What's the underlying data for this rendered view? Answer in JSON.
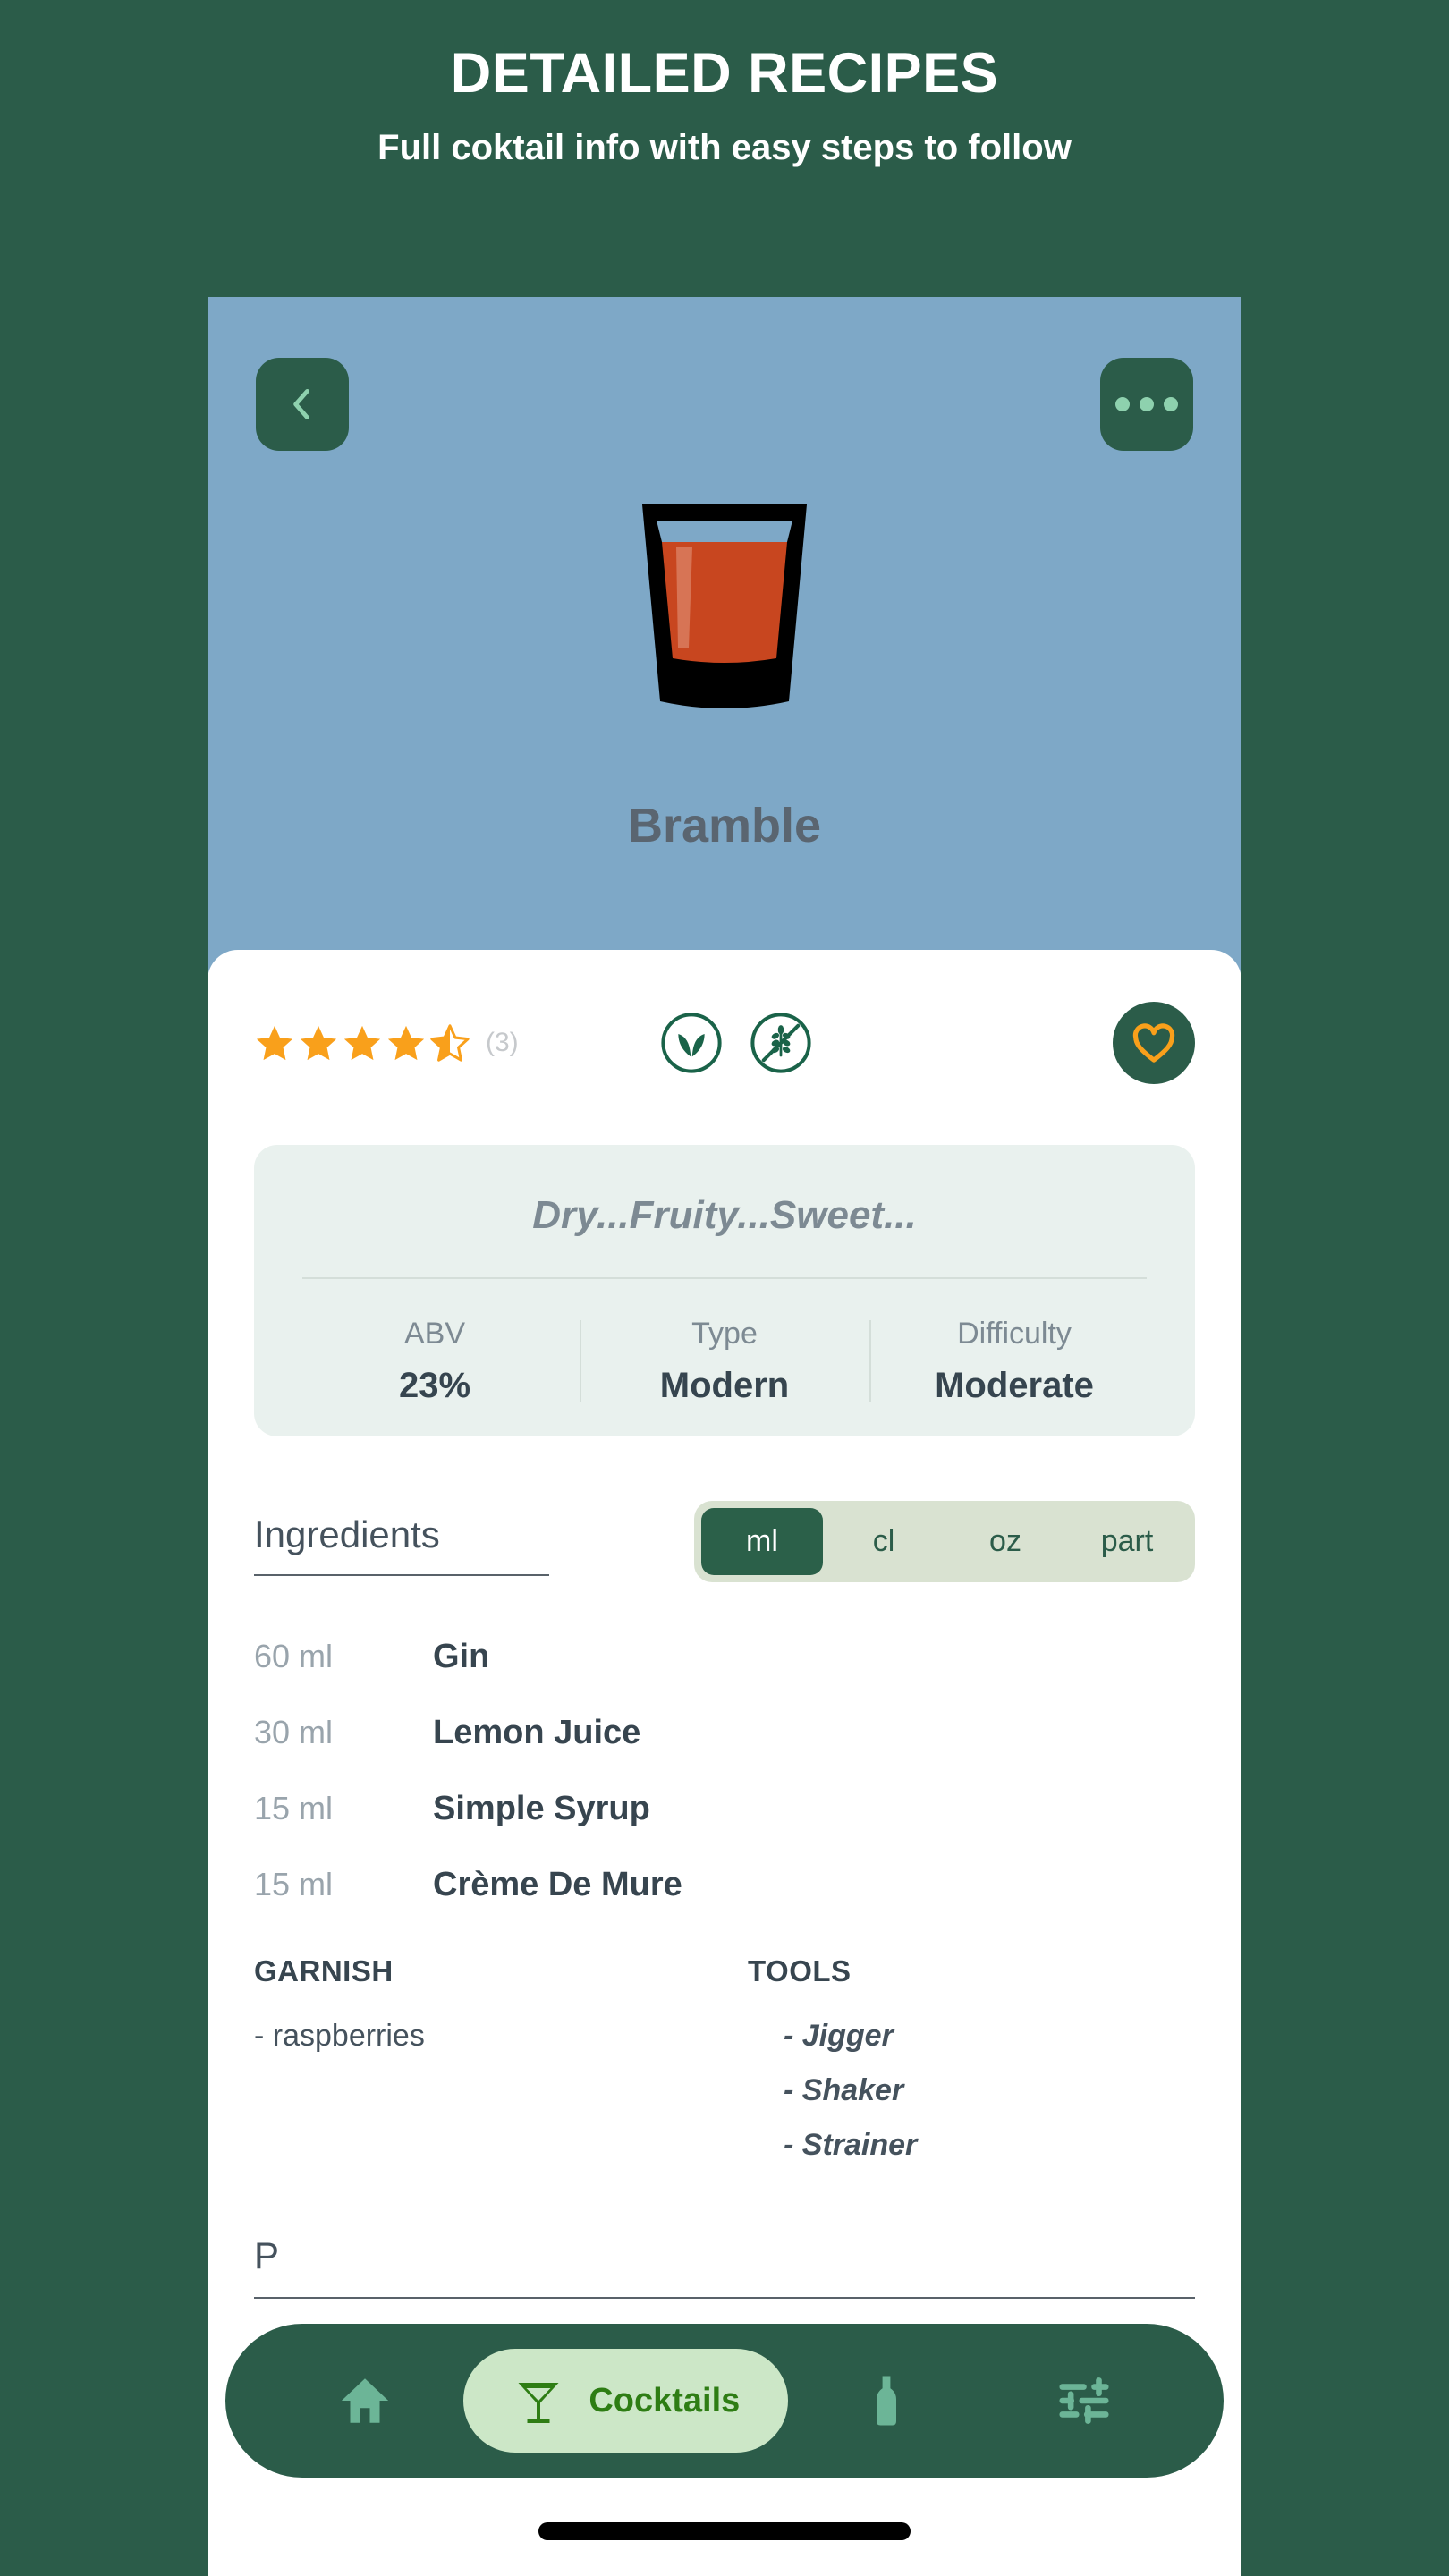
{
  "promo": {
    "title": "DETAILED RECIPES",
    "subtitle": "Full coktail info with easy steps to follow"
  },
  "colors": {
    "background_green": "#2b5c49",
    "hero_blue": "#7ea8c7",
    "accent_orange": "#f9a01b",
    "card_mint": "#e9f1ee",
    "pill_mint": "#cce7c7",
    "active_green": "#2e7d14",
    "slate": "#37454f"
  },
  "hero": {
    "back_icon": "chevron-left-icon",
    "more_icon": "more-horizontal-icon",
    "drink_illustration": "rocks-glass-icon",
    "drink_name": "Bramble"
  },
  "rating": {
    "value": 4.5,
    "max": 5,
    "count_label": "(3)",
    "badges": [
      {
        "icon": "leaf-vegan-icon",
        "name": "vegan"
      },
      {
        "icon": "gluten-free-icon",
        "name": "gluten-free"
      }
    ],
    "favorite_icon": "heart-icon"
  },
  "info_card": {
    "tagline": "Dry...Fruity...Sweet...",
    "stats": [
      {
        "label": "ABV",
        "value": "23%"
      },
      {
        "label": "Type",
        "value": "Modern"
      },
      {
        "label": "Difficulty",
        "value": "Moderate"
      }
    ]
  },
  "ingredients_section": {
    "title": "Ingredients",
    "units": [
      "ml",
      "cl",
      "oz",
      "part"
    ],
    "selected_unit": "ml",
    "items": [
      {
        "amount": "60 ml",
        "name": "Gin"
      },
      {
        "amount": "30 ml",
        "name": "Lemon Juice"
      },
      {
        "amount": "15 ml",
        "name": "Simple Syrup"
      },
      {
        "amount": "15 ml",
        "name": "Crème De Mure"
      }
    ]
  },
  "garnish": {
    "heading": "GARNISH",
    "items": [
      "-  raspberries"
    ]
  },
  "tools": {
    "heading": "TOOLS",
    "items": [
      "-  Jigger",
      "-  Shaker",
      "-  Strainer"
    ]
  },
  "preparation": {
    "title": "P"
  },
  "bottom_nav": {
    "items": [
      {
        "icon": "home-icon",
        "label": "",
        "active": false
      },
      {
        "icon": "cocktail-glass-icon",
        "label": "Cocktails",
        "active": true
      },
      {
        "icon": "bottle-icon",
        "label": "",
        "active": false
      },
      {
        "icon": "sliders-icon",
        "label": "",
        "active": false
      }
    ]
  }
}
